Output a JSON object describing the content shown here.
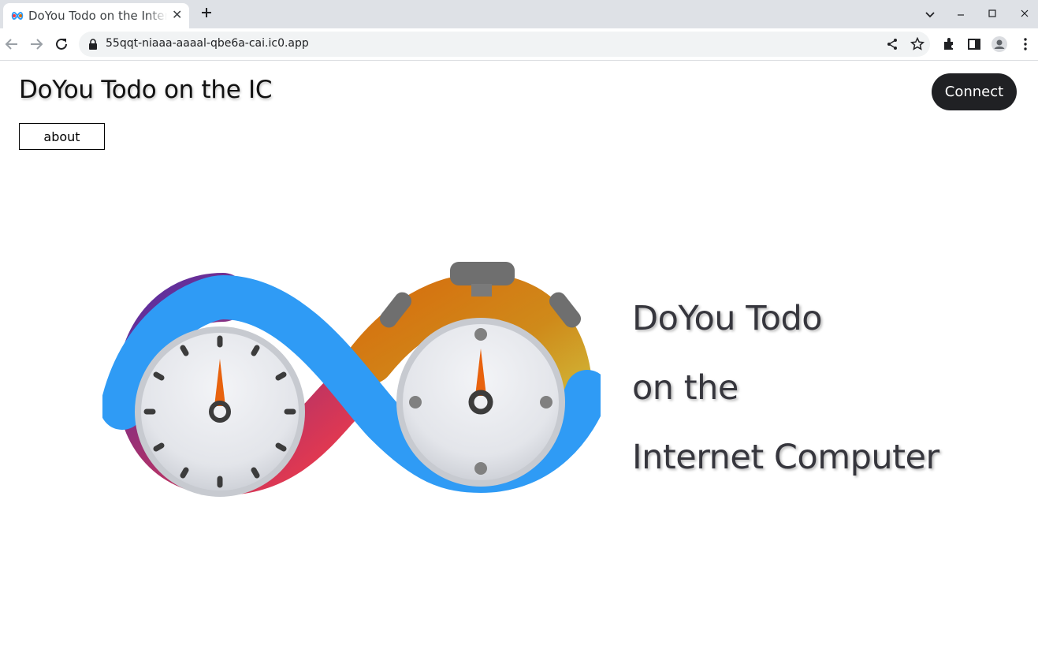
{
  "browser": {
    "tab": {
      "title": "DoYou Todo on the Internet Computer",
      "favicon": "infinity-icon"
    },
    "address_bar": {
      "url": "55qqt-niaaa-aaaal-qbe6a-cai.ic0.app"
    },
    "icons": [
      "back-icon",
      "forward-icon",
      "reload-icon",
      "lock-icon",
      "share-icon",
      "star-icon",
      "extensions-icon",
      "side-panel-icon",
      "profile-icon",
      "menu-icon",
      "tab-search-icon",
      "minimize-icon",
      "maximize-icon",
      "close-icon"
    ]
  },
  "header": {
    "title": "DoYou Todo on the IC",
    "connect_label": "Connect",
    "about_label": "about"
  },
  "hero": {
    "line1": "DoYou Todo",
    "line2": "on the",
    "line3": "Internet Computer",
    "logo": "infinity-stopwatch-logo"
  },
  "colors": {
    "connect_bg": "#202124",
    "infinity_blue": "#2f9bf5",
    "infinity_purple": "#6b2f8f",
    "infinity_red": "#ef3a4a",
    "infinity_orange": "#d6700f",
    "infinity_yellow": "#d0bb3a",
    "hand_orange": "#e8620e"
  }
}
